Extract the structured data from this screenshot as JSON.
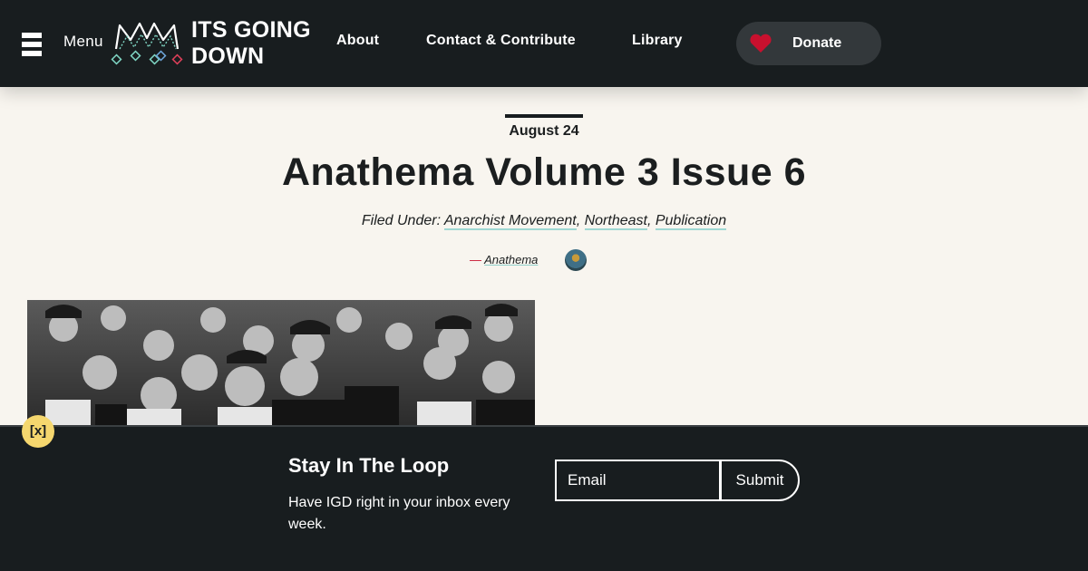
{
  "header": {
    "menu_label": "Menu",
    "logo_line1": "ITS GOING",
    "logo_line2": "DOWN",
    "nav": [
      {
        "label": "About"
      },
      {
        "label": "Contact & Contribute"
      },
      {
        "label": "Library"
      }
    ],
    "donate_label": "Donate",
    "colors": {
      "bar": "#181d1f",
      "heart": "#c8102e",
      "donate_bg": "#33383b"
    }
  },
  "article": {
    "date": "August 24",
    "title": "Anathema Volume 3 Issue 6",
    "filed_prefix": "Filed Under: ",
    "categories": [
      "Anarchist Movement",
      "Northeast",
      "Publication"
    ],
    "author_dash": "— ",
    "author": "Anathema"
  },
  "newsletter": {
    "title": "Stay In The Loop",
    "text": "Have IGD right in your inbox every week.",
    "email_placeholder": "Email",
    "submit_label": "Submit",
    "close_label": "[x]",
    "colors": {
      "close_badge": "#f5d76e"
    }
  },
  "icons": [
    "hamburger-icon",
    "logo-crown-icon",
    "heart-icon",
    "avatar"
  ]
}
